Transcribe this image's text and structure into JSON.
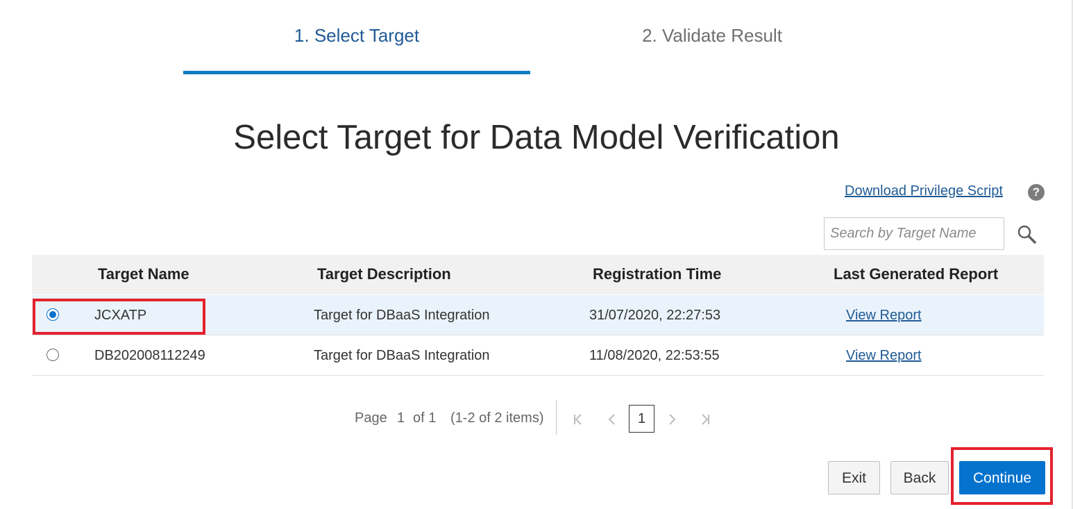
{
  "wizard": {
    "steps": [
      {
        "label": "1. Select Target",
        "state": "active"
      },
      {
        "label": "2. Validate Result",
        "state": "inactive"
      }
    ]
  },
  "page": {
    "title": "Select Target for Data Model Verification"
  },
  "actions": {
    "download_privilege_script": "Download Privilege Script",
    "help_icon_glyph": "?"
  },
  "search": {
    "placeholder": "Search by Target Name",
    "value": ""
  },
  "table": {
    "columns": [
      "Target Name",
      "Target Description",
      "Registration Time",
      "Last Generated Report"
    ],
    "rows": [
      {
        "selected": true,
        "target_name": "JCXATP",
        "description": "Target for DBaaS Integration",
        "registration_time": "31/07/2020, 22:27:53",
        "report_link": "View Report"
      },
      {
        "selected": false,
        "target_name": "DB202008112249",
        "description": "Target for DBaaS Integration",
        "registration_time": "11/08/2020, 22:53:55",
        "report_link": "View Report"
      }
    ]
  },
  "pagination": {
    "page_label": "Page",
    "page_value": "1",
    "of_label": "of 1",
    "items_label": "(1-2 of 2 items)",
    "current_page": "1"
  },
  "buttons": {
    "exit": "Exit",
    "back": "Back",
    "continue": "Continue"
  },
  "colors": {
    "accent": "#0572ce",
    "active_step": "#1f5a96",
    "step_underline": "#0f7bc0",
    "selected_row": "#eaf3fb",
    "annotation_red": "#e3222e"
  }
}
